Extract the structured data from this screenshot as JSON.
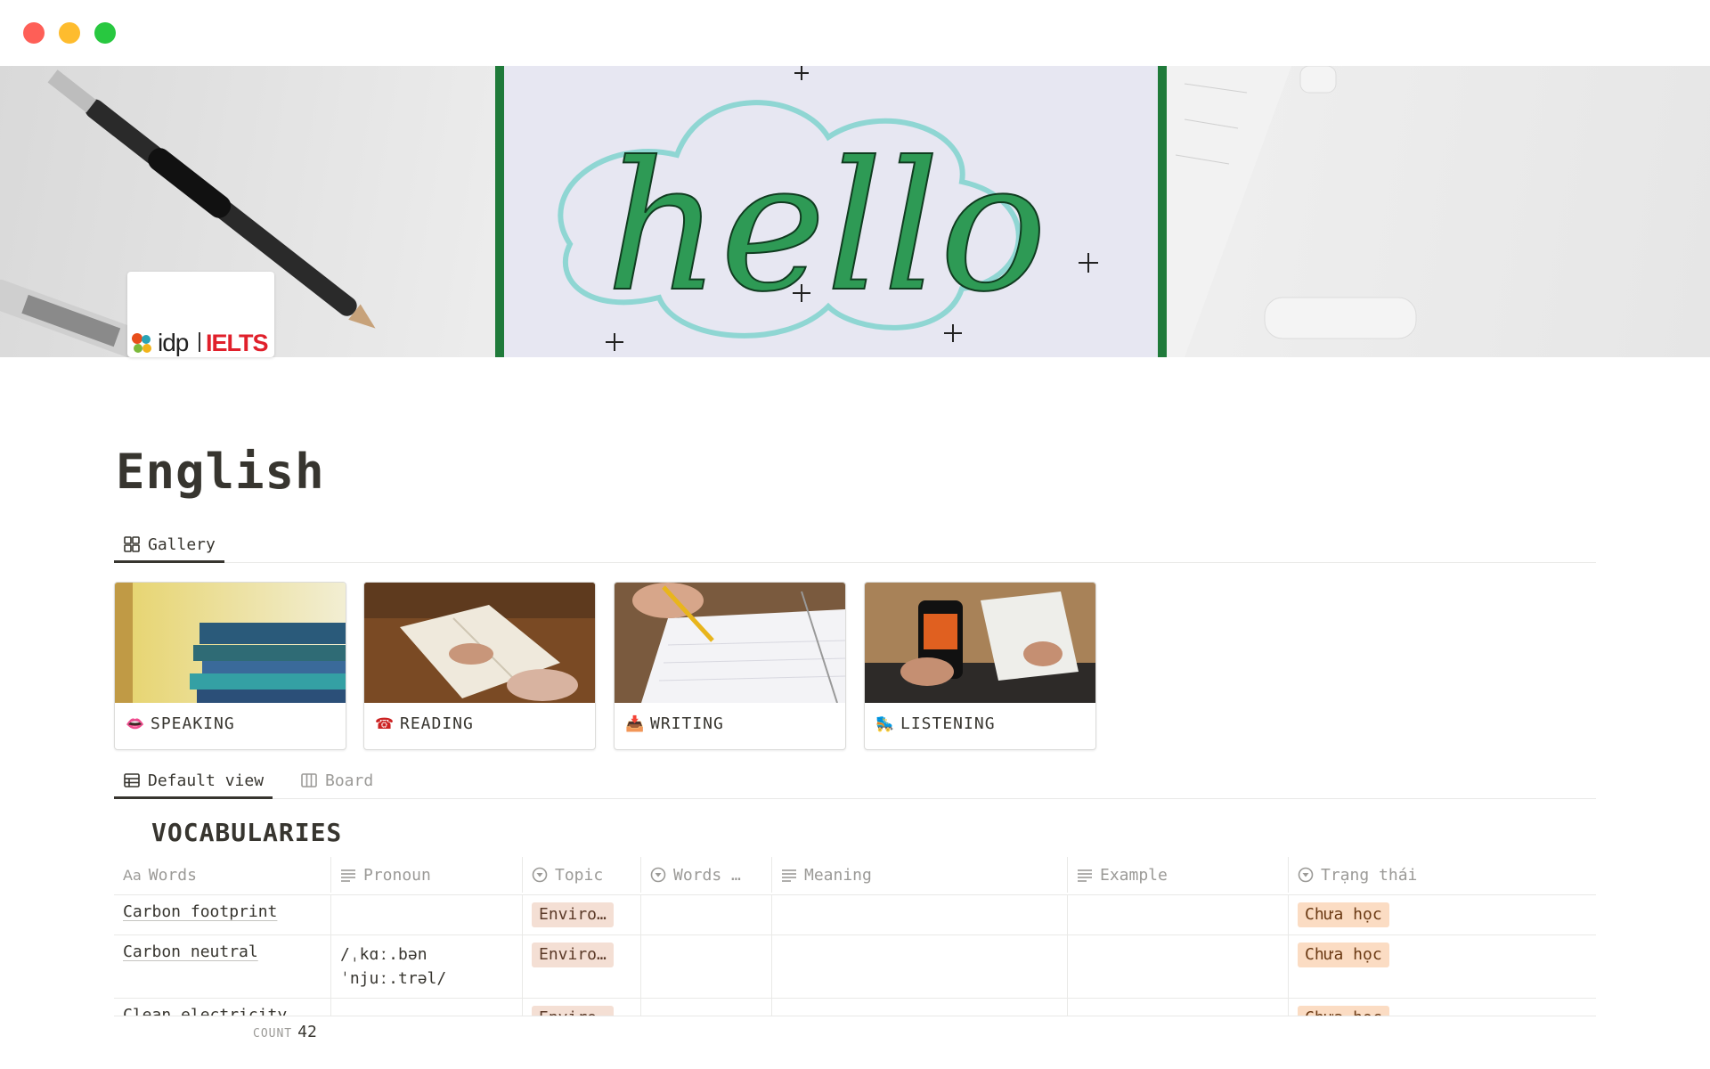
{
  "page": {
    "title": "English"
  },
  "cover": {
    "banner_text": "hello",
    "logo_brand": "idp",
    "logo_product": "IELTS"
  },
  "gallery_tabs": [
    {
      "label": "Gallery"
    }
  ],
  "gallery": [
    {
      "title": "SPEAKING",
      "emoji": "👄"
    },
    {
      "title": "READING",
      "emoji": "☎"
    },
    {
      "title": "WRITING",
      "emoji": "📥"
    },
    {
      "title": "LISTENING",
      "emoji": "🛼"
    }
  ],
  "db_tabs": [
    {
      "label": "Default view"
    },
    {
      "label": "Board"
    }
  ],
  "database": {
    "title": "VOCABULARIES",
    "columns": {
      "words": {
        "prefix": "Aa",
        "label": "Words"
      },
      "pronoun": {
        "label": "Pronoun"
      },
      "topic": {
        "label": "Topic"
      },
      "words2": {
        "label": "Words …"
      },
      "meaning": {
        "label": "Meaning"
      },
      "example": {
        "label": "Example"
      },
      "status": {
        "label": "Trạng thái"
      }
    },
    "rows": [
      {
        "word": "Carbon footprint",
        "pronoun": "",
        "topic": "Enviro…",
        "status": "Chưa học"
      },
      {
        "word": "Carbon neutral",
        "pronoun_line1": "/ˌkɑː.bən",
        "pronoun_line2": "ˈnjuː.trəl/",
        "topic": "Enviro…",
        "status": "Chưa học"
      },
      {
        "word": "Clean electricity",
        "topic": "Enviro…",
        "status": "Chưa học"
      }
    ],
    "count_label": "COUNT",
    "count_value": "42"
  },
  "colors": {
    "accent_status": "#fbdcc3",
    "accent_topic": "#f4dfd4",
    "text": "#37352f"
  }
}
